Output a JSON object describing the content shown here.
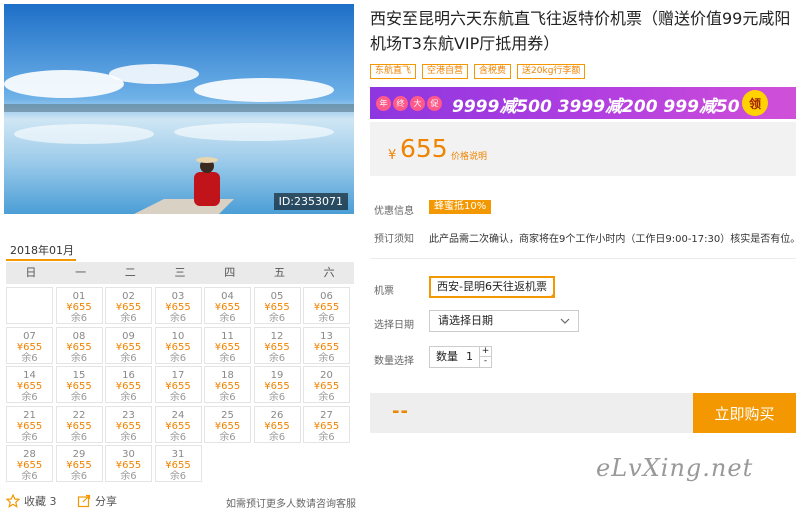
{
  "image": {
    "id_label": "ID:2353071"
  },
  "title": "西安至昆明六天东航直飞往返特价机票（赠送价值99元咸阳机场T3东航VIP厅抵用券）",
  "tags": [
    "东航直飞",
    "空港自营",
    "含税费",
    "送20kg行李额"
  ],
  "promo": {
    "badge_chars": [
      "年",
      "终",
      "大",
      "促"
    ],
    "deals": "9999减500  3999减200  999减50",
    "claim": "领"
  },
  "price": {
    "currency": "¥",
    "value": "655",
    "note": "价格说明"
  },
  "offer": {
    "label": "优惠信息",
    "badge": "蜂蜜抵10%"
  },
  "booking_notice": {
    "label": "预订须知",
    "text": "此产品需二次确认，商家将在9个工作小时内（工作日9:00-17:30）核实是否有位。"
  },
  "ticket": {
    "label": "机票",
    "value": "西安-昆明6天往返机票"
  },
  "date": {
    "label": "选择日期",
    "value": "请选择日期"
  },
  "quantity": {
    "label": "数量选择",
    "unit": "数量",
    "value": "1",
    "plus": "+",
    "minus": "-"
  },
  "buy": {
    "price_placeholder": "--",
    "button": "立即购买"
  },
  "calendar": {
    "month": "2018年01月",
    "weekdays": [
      "日",
      "一",
      "二",
      "三",
      "四",
      "五",
      "六"
    ],
    "leading_blanks": 1,
    "price": "¥655",
    "stock": "余6",
    "days": [
      "01",
      "02",
      "03",
      "04",
      "05",
      "06",
      "07",
      "08",
      "09",
      "10",
      "11",
      "12",
      "13",
      "14",
      "15",
      "16",
      "17",
      "18",
      "19",
      "20",
      "21",
      "22",
      "23",
      "24",
      "25",
      "26",
      "27",
      "28",
      "29",
      "30",
      "31"
    ]
  },
  "footer": {
    "favorite": "收藏 3",
    "share": "分享",
    "consult": "如需预订更多人数请咨询客服"
  },
  "watermark": "eLvXing.net",
  "colors": {
    "accent": "#f39800",
    "price": "#f08300",
    "promo_start": "#8d36e0",
    "promo_end": "#d050d8"
  }
}
